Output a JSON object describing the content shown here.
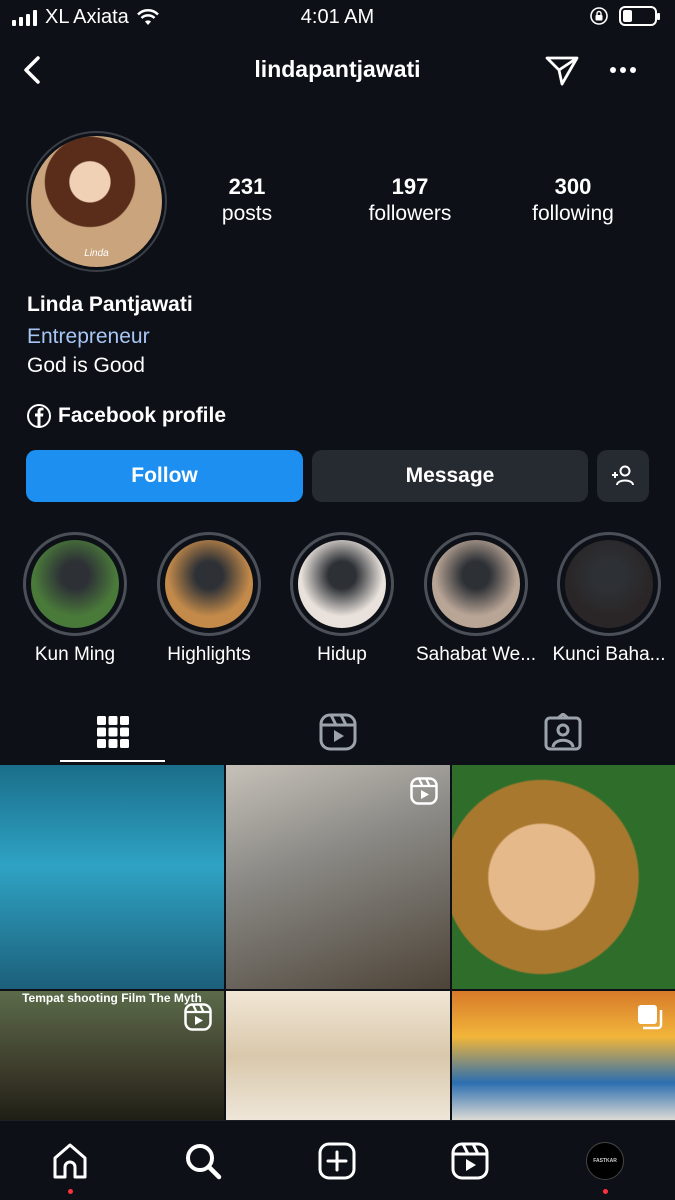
{
  "status_bar": {
    "carrier": "XL Axiata",
    "time": "4:01 AM",
    "battery_level": 0.3
  },
  "header": {
    "username": "lindapantjawati"
  },
  "profile": {
    "avatar_caption": "Linda",
    "stats": [
      {
        "value": "231",
        "label": "posts"
      },
      {
        "value": "197",
        "label": "followers"
      },
      {
        "value": "300",
        "label": "following"
      }
    ],
    "full_name": "Linda Pantjawati",
    "category": "Entrepreneur",
    "bio": "God is Good",
    "link_label": "Facebook profile"
  },
  "actions": {
    "follow_label": "Follow",
    "message_label": "Message"
  },
  "highlights": [
    {
      "label": "Kun Ming",
      "color": "#4a7a3a"
    },
    {
      "label": "Highlights",
      "color": "#c38a4a"
    },
    {
      "label": "Hidup",
      "color": "#e9e2dc"
    },
    {
      "label": "Sahabat We...",
      "color": "#b9a596"
    },
    {
      "label": "Kunci Baha...",
      "color": "#2a2627"
    }
  ],
  "tabs": [
    {
      "name": "grid",
      "icon": "grid-icon"
    },
    {
      "name": "reels",
      "icon": "reels-icon"
    },
    {
      "name": "tagged",
      "icon": "tagged-icon"
    }
  ],
  "grid": {
    "posts": [
      {
        "kind": "photo",
        "caption": ""
      },
      {
        "kind": "reel",
        "caption": ""
      },
      {
        "kind": "photo",
        "caption": ""
      },
      {
        "kind": "reel",
        "caption": "Tempat shooting Film The Myth"
      },
      {
        "kind": "photo",
        "caption": ""
      },
      {
        "kind": "carousel",
        "caption": ""
      }
    ]
  },
  "bottom_nav": {
    "items": [
      "home-icon",
      "search-icon",
      "create-icon",
      "reels-icon",
      "profile-avatar"
    ],
    "profile_avatar_text": "FASTKAR"
  },
  "colors": {
    "background": "#0d1117",
    "follow_blue": "#1d8ff0",
    "secondary_button": "#262a31",
    "link_blue": "#a8c6f5",
    "notification_red": "#ff3040"
  }
}
